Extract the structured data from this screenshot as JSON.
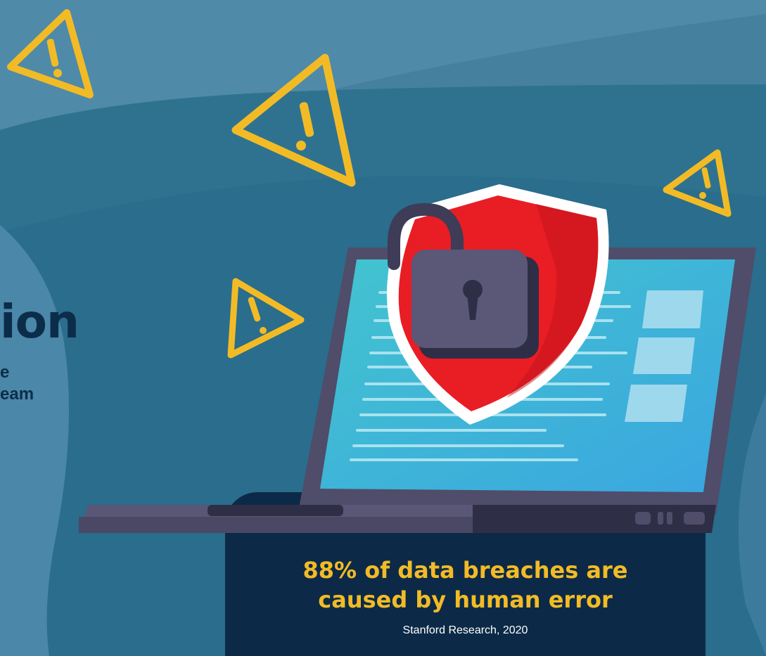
{
  "headline": {
    "fragment": "ion"
  },
  "subtitle": {
    "line1": "e",
    "line2": "eam"
  },
  "stat": {
    "line1": "88% of data breaches are",
    "line2": "caused by human error",
    "source": "Stanford Research, 2020"
  },
  "colors": {
    "background": "#2a6d8c",
    "warning": "#f2bb26",
    "shield": "#e91d24",
    "laptop": "#4f4d6a",
    "screen": "#3ab8d4",
    "panel": "#0c2a47",
    "text_dark": "#0c2d4a"
  },
  "icons": [
    "warning-icon",
    "shield-icon",
    "open-padlock-icon",
    "laptop-icon"
  ]
}
